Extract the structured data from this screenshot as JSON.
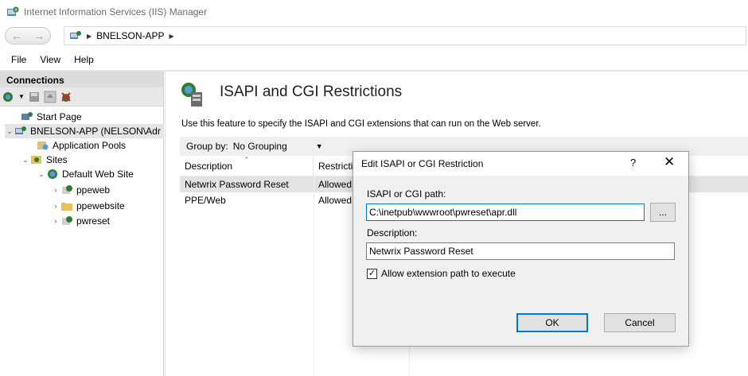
{
  "window": {
    "title": "Internet Information Services (IIS) Manager"
  },
  "address": {
    "segments": [
      "BNELSON-APP"
    ]
  },
  "menu": {
    "items": [
      "File",
      "View",
      "Help"
    ]
  },
  "connections": {
    "header": "Connections",
    "tree": [
      {
        "label": "Start Page",
        "icon": "start-page-icon"
      },
      {
        "label": "BNELSON-APP (NELSON\\Adr",
        "icon": "server-icon"
      },
      {
        "label": "Application Pools",
        "icon": "app-pools-icon"
      },
      {
        "label": "Sites",
        "icon": "sites-folder-icon"
      },
      {
        "label": "Default Web Site",
        "icon": "globe-icon"
      },
      {
        "label": "ppeweb",
        "icon": "web-app-icon"
      },
      {
        "label": "ppewebsite",
        "icon": "folder-icon"
      },
      {
        "label": "pwreset",
        "icon": "web-app-icon"
      }
    ]
  },
  "feature": {
    "title": "ISAPI and CGI Restrictions",
    "description": "Use this feature to specify the ISAPI and CGI extensions that can run on the Web server.",
    "group_by_label": "Group by:",
    "group_by_value": "No Grouping",
    "columns": [
      "Description",
      "Restrictio"
    ],
    "rows": [
      {
        "description": "Netwrix Password Reset",
        "restriction": "Allowed"
      },
      {
        "description": "PPE/Web",
        "restriction": "Allowed"
      }
    ]
  },
  "dialog": {
    "title": "Edit ISAPI or CGI Restriction",
    "help": "?",
    "close": "✕",
    "path_label": "ISAPI or CGI path:",
    "path_value": "C:\\inetpub\\wwwroot\\pwreset\\apr.dll",
    "browse_label": "...",
    "description_label": "Description:",
    "description_value": "Netwrix Password Reset",
    "allow_label": "Allow extension path to execute",
    "allow_checked": true,
    "ok_label": "OK",
    "cancel_label": "Cancel"
  },
  "colors": {
    "accent": "#0078d7",
    "selection": "#e3e3e3",
    "pane_header": "#dcdcdc"
  }
}
